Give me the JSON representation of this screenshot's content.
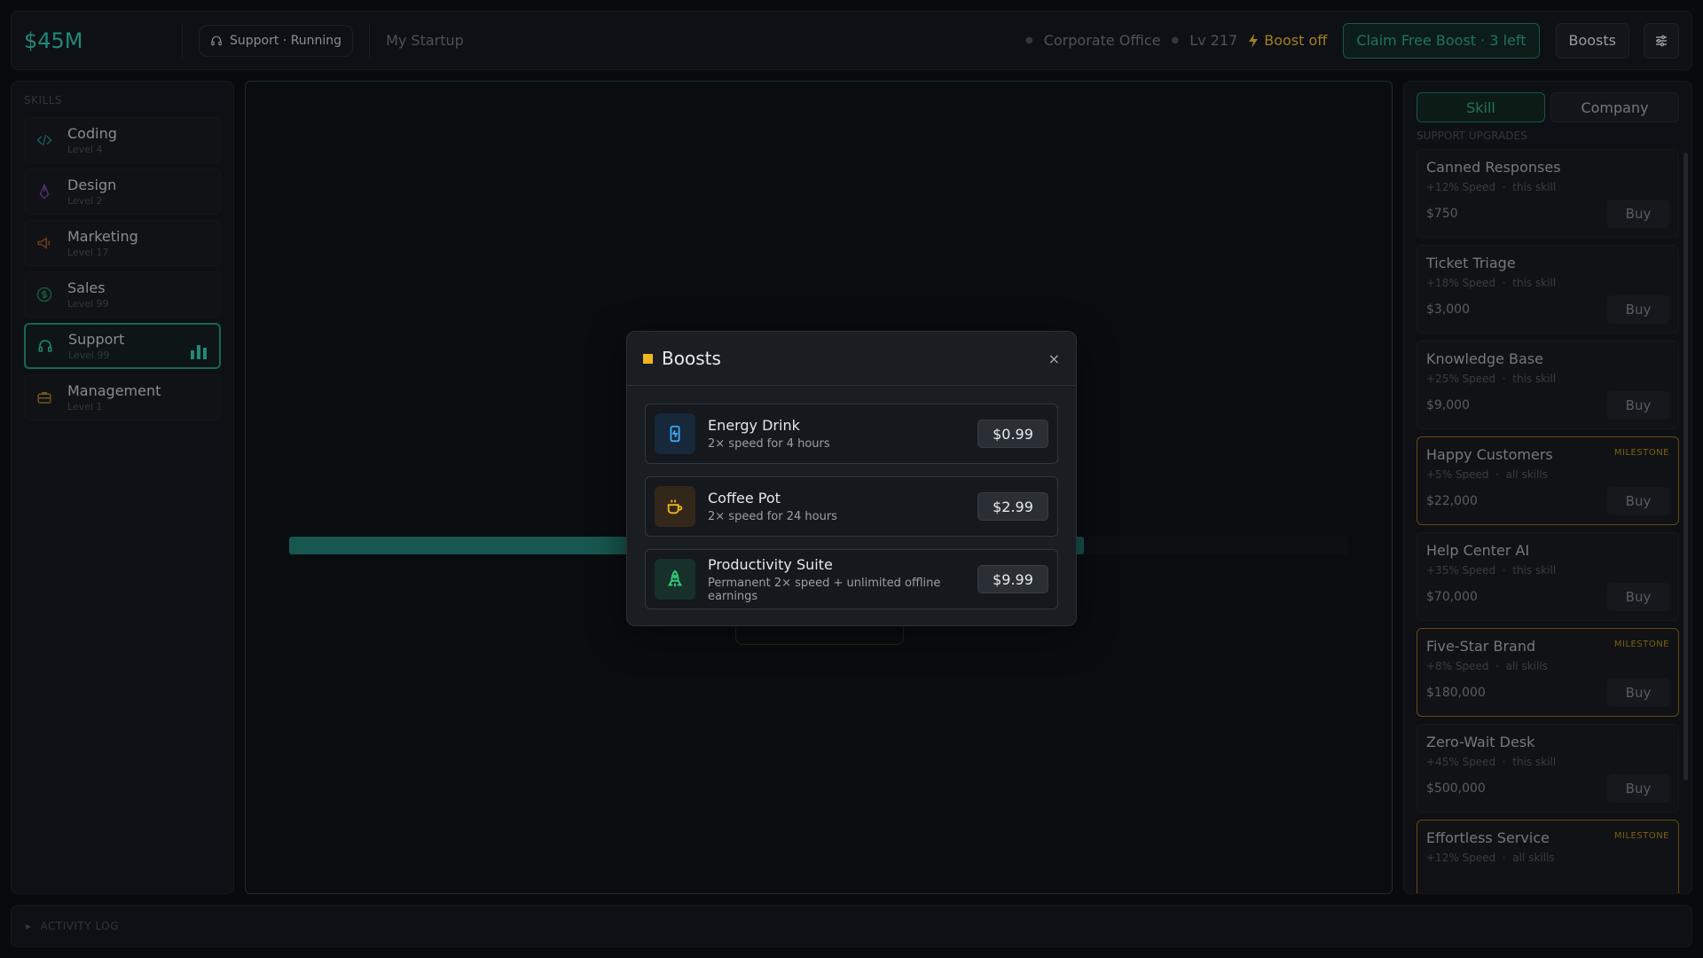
{
  "topbar": {
    "money": "$45M",
    "status": "Support · Running",
    "company": "My Startup",
    "office": "Corporate Office",
    "level": "Lv 217",
    "boost_status": "Boost off",
    "claim_label": "Claim Free Boost · 3 left",
    "boosts_label": "Boosts"
  },
  "sidebar": {
    "section_label": "SKILLS",
    "skills": [
      {
        "name": "Coding",
        "level": "Level 4",
        "icon": "code-icon"
      },
      {
        "name": "Design",
        "level": "Level 2",
        "icon": "pen-icon"
      },
      {
        "name": "Marketing",
        "level": "Level 17",
        "icon": "megaphone-icon"
      },
      {
        "name": "Sales",
        "level": "Level 99",
        "icon": "dollar-icon"
      },
      {
        "name": "Support",
        "level": "Level 99",
        "icon": "headset-icon",
        "active": true
      },
      {
        "name": "Management",
        "level": "Level 1",
        "icon": "briefcase-icon"
      }
    ]
  },
  "main": {
    "progress": 0.75
  },
  "right_panel": {
    "tabs": [
      "Skill",
      "Company"
    ],
    "section_label": "SUPPORT UPGRADES",
    "upgrades": [
      {
        "name": "Canned Responses",
        "speed": "+12% Speed",
        "scope": "this skill",
        "price": "$750",
        "buy": "Buy"
      },
      {
        "name": "Ticket Triage",
        "speed": "+18% Speed",
        "scope": "this skill",
        "price": "$3,000",
        "buy": "Buy"
      },
      {
        "name": "Knowledge Base",
        "speed": "+25% Speed",
        "scope": "this skill",
        "price": "$9,000",
        "buy": "Buy"
      },
      {
        "name": "Happy Customers",
        "speed": "+5% Speed",
        "scope": "all skills",
        "price": "$22,000",
        "buy": "Buy",
        "badge": "MILESTONE"
      },
      {
        "name": "Help Center AI",
        "speed": "+35% Speed",
        "scope": "this skill",
        "price": "$70,000",
        "buy": "Buy"
      },
      {
        "name": "Five-Star Brand",
        "speed": "+8% Speed",
        "scope": "all skills",
        "price": "$180,000",
        "buy": "Buy",
        "badge": "MILESTONE"
      },
      {
        "name": "Zero-Wait Desk",
        "speed": "+45% Speed",
        "scope": "this skill",
        "price": "$500,000",
        "buy": "Buy"
      },
      {
        "name": "Effortless Service",
        "speed": "+12% Speed",
        "scope": "all skills",
        "price": "",
        "buy": "",
        "badge": "MILESTONE"
      }
    ]
  },
  "activity_log": {
    "label": "ACTIVITY LOG"
  },
  "modal": {
    "title": "Boosts",
    "close": "×",
    "items": [
      {
        "name": "Energy Drink",
        "desc": "2× speed for 4 hours",
        "price": "$0.99",
        "icon": "energy-drink-icon",
        "color": "#3fa9f5"
      },
      {
        "name": "Coffee Pot",
        "desc": "2× speed for 24 hours",
        "price": "$2.99",
        "icon": "coffee-icon",
        "color": "#f1b51e"
      },
      {
        "name": "Productivity Suite",
        "desc": "Permanent 2× speed + unlimited offline earnings",
        "price": "$9.99",
        "icon": "rocket-icon",
        "color": "#34d17a"
      }
    ]
  },
  "colors": {
    "accent": "#2aa791",
    "warning": "#c79a2b",
    "milestone": "#7a5b14"
  }
}
